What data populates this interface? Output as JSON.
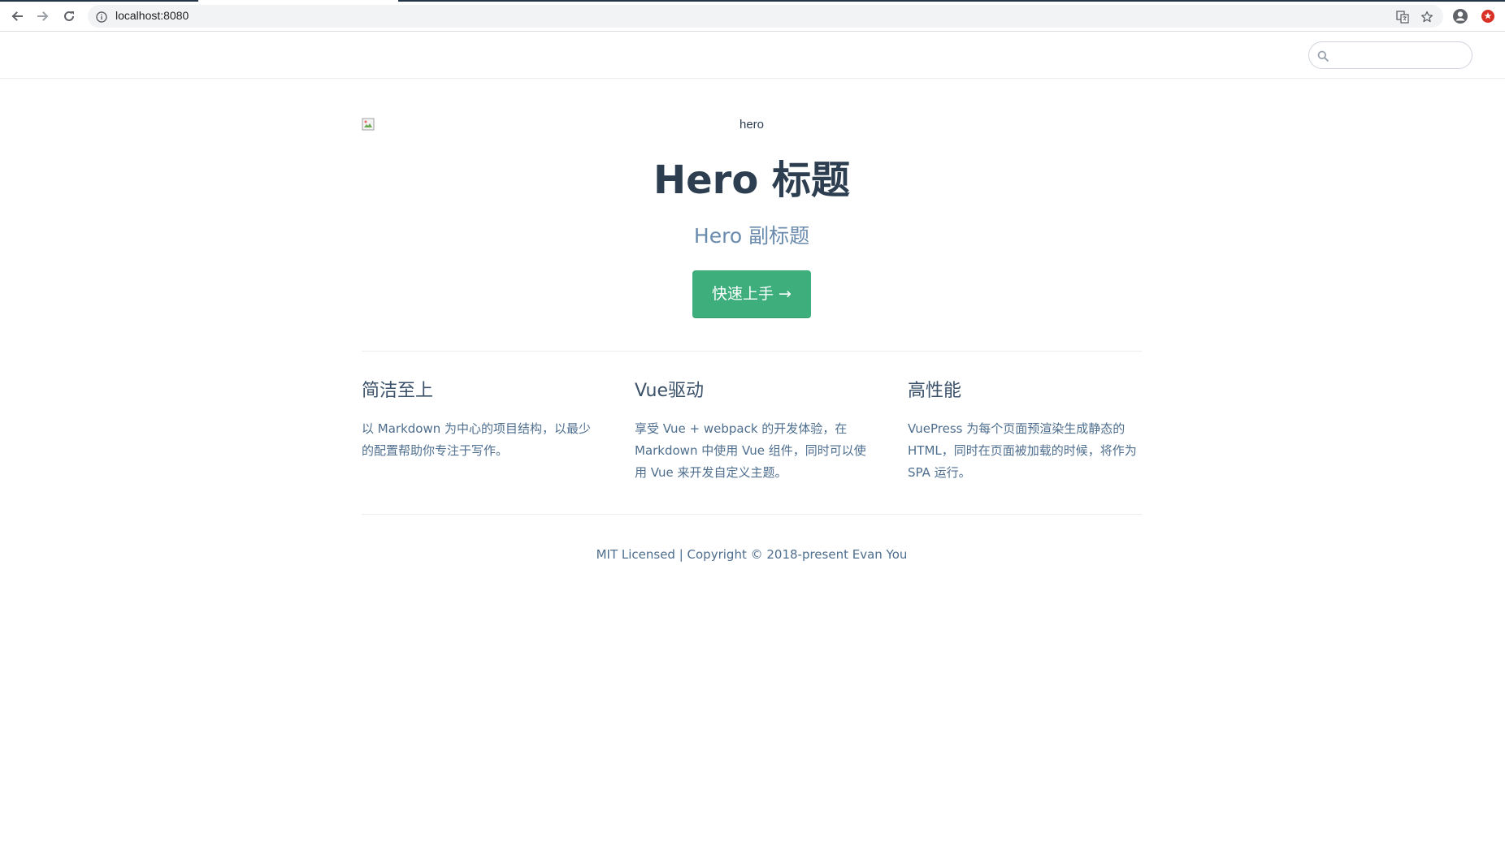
{
  "browser": {
    "url": "localhost:8080",
    "nav": {
      "back_icon": "arrow-left-icon",
      "forward_icon": "arrow-right-icon",
      "reload_icon": "reload-icon"
    },
    "omnibox_icons": [
      "info-icon",
      "translate-icon",
      "star-icon"
    ],
    "toolbar_icons": [
      "account-icon",
      "extension-icon"
    ]
  },
  "navbar": {
    "search": {
      "placeholder": "",
      "value": "",
      "icon": "search-icon"
    }
  },
  "hero": {
    "image_alt": "hero",
    "title": "Hero 标题",
    "subtitle": "Hero 副标题",
    "action_label": "快速上手 →"
  },
  "features": [
    {
      "title": "简洁至上",
      "details": "以 Markdown 为中心的项目结构，以最少的配置帮助你专注于写作。"
    },
    {
      "title": "Vue驱动",
      "details": "享受 Vue + webpack 的开发体验，在 Markdown 中使用 Vue 组件，同时可以使用 Vue 来开发自定义主题。"
    },
    {
      "title": "高性能",
      "details": "VuePress 为每个页面预渲染生成静态的 HTML，同时在页面被加载的时候，将作为 SPA 运行。"
    }
  ],
  "footer": {
    "text": "MIT Licensed | Copyright © 2018-present Evan You"
  },
  "colors": {
    "accent": "#3eaf7c",
    "text": "#2c3e50",
    "subtitle": "#6a8bad",
    "details": "#4e6e8e",
    "border": "#eaecef"
  }
}
